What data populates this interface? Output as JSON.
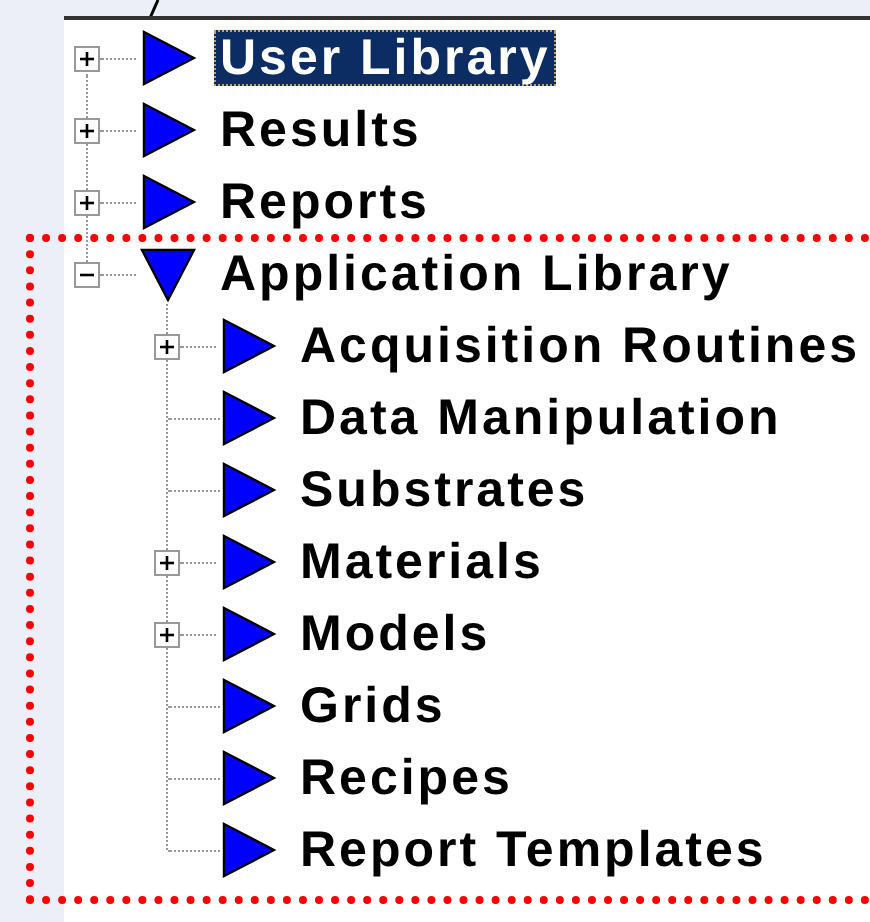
{
  "tree": [
    {
      "label": "User Library",
      "selected": true,
      "expanded": false
    },
    {
      "label": "Results",
      "selected": false,
      "expanded": false
    },
    {
      "label": "Reports",
      "selected": false,
      "expanded": false
    },
    {
      "label": "Application Library",
      "selected": false,
      "expanded": true,
      "children": [
        {
          "label": "Acquisition Routines",
          "selected": false,
          "expanded": false
        },
        {
          "label": "Data Manipulation",
          "selected": false
        },
        {
          "label": "Substrates",
          "selected": false
        },
        {
          "label": "Materials",
          "selected": false,
          "expanded": false
        },
        {
          "label": "Models",
          "selected": false,
          "expanded": false
        },
        {
          "label": "Grids",
          "selected": false
        },
        {
          "label": "Recipes",
          "selected": false
        },
        {
          "label": "Report Templates",
          "selected": false
        }
      ]
    }
  ]
}
